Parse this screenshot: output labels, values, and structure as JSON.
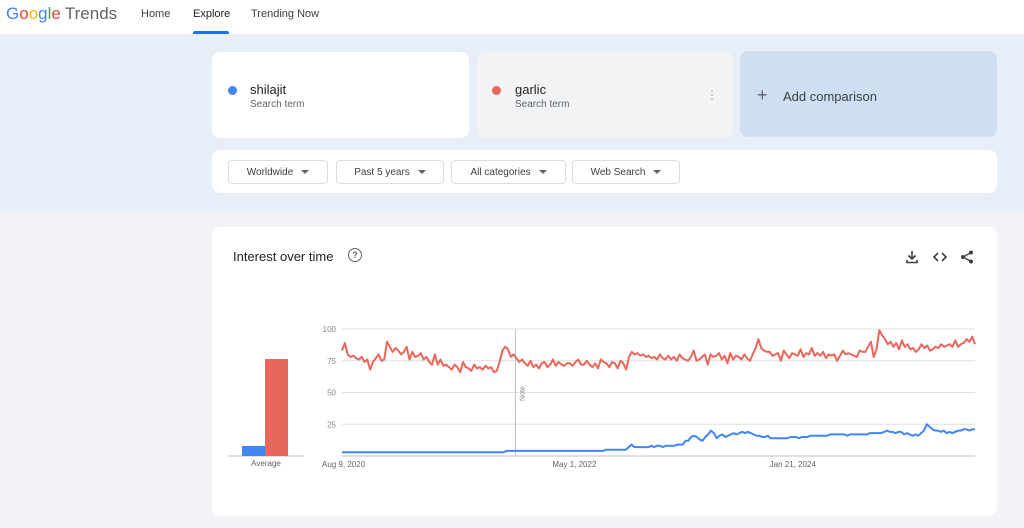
{
  "header": {
    "logo": {
      "google": [
        "G",
        "o",
        "o",
        "g",
        "l",
        "e"
      ],
      "trends": "Trends"
    },
    "nav": [
      {
        "label": "Home"
      },
      {
        "label": "Explore",
        "active": true
      },
      {
        "label": "Trending Now"
      }
    ]
  },
  "terms": [
    {
      "name": "shilajit",
      "subtitle": "Search term",
      "color": "#4285f4"
    },
    {
      "name": "garlic",
      "subtitle": "Search term",
      "color": "#e8675b"
    }
  ],
  "add_comparison": {
    "icon": "plus-icon",
    "label": "Add comparison"
  },
  "filters": [
    {
      "label": "Worldwide"
    },
    {
      "label": "Past 5 years"
    },
    {
      "label": "All categories"
    },
    {
      "label": "Web Search"
    }
  ],
  "interest_card": {
    "title": "Interest over time",
    "icons": [
      "help-icon",
      "download-icon",
      "embed-icon",
      "share-icon"
    ]
  },
  "chart_data": [
    {
      "type": "bar",
      "categories": [
        "Average"
      ],
      "series": [
        {
          "name": "shilajit",
          "values": [
            8
          ],
          "color": "#4285f4"
        },
        {
          "name": "garlic",
          "values": [
            77
          ],
          "color": "#e8675b"
        }
      ],
      "ylim": [
        0,
        100
      ]
    },
    {
      "type": "line",
      "x_ticks": [
        "Aug 9, 2020",
        "May 1, 2022",
        "Jan 21, 2024"
      ],
      "y_ticks": [
        "100",
        "75",
        "50",
        "25"
      ],
      "ylim": [
        0,
        100
      ],
      "annotation": "Note",
      "annotation_at": 0.274,
      "series": [
        {
          "name": "garlic",
          "color": "#e8675b",
          "values": [
            83,
            89,
            80,
            78,
            79,
            77,
            76,
            78,
            74,
            76,
            68,
            74,
            77,
            80,
            75,
            76,
            90,
            86,
            82,
            85,
            83,
            80,
            82,
            86,
            76,
            82,
            78,
            79,
            81,
            76,
            78,
            74,
            72,
            80,
            72,
            76,
            71,
            72,
            70,
            68,
            72,
            70,
            66,
            74,
            70,
            69,
            67,
            72,
            69,
            70,
            68,
            71,
            69,
            70,
            66,
            67,
            74,
            83,
            86,
            84,
            78,
            80,
            77,
            74,
            76,
            73,
            71,
            75,
            70,
            72,
            69,
            73,
            74,
            70,
            72,
            76,
            71,
            74,
            72,
            71,
            73,
            73,
            71,
            74,
            76,
            72,
            72,
            75,
            72,
            70,
            73,
            69,
            76,
            74,
            73,
            70,
            74,
            73,
            69,
            75,
            73,
            68,
            78,
            82,
            80,
            81,
            79,
            80,
            78,
            79,
            77,
            78,
            76,
            80,
            77,
            76,
            79,
            76,
            78,
            75,
            80,
            77,
            76,
            75,
            78,
            83,
            75,
            76,
            78,
            80,
            72,
            80,
            78,
            79,
            81,
            76,
            79,
            73,
            81,
            76,
            79,
            78,
            76,
            80,
            77,
            75,
            80,
            85,
            92,
            85,
            83,
            82,
            82,
            79,
            80,
            81,
            75,
            83,
            80,
            77,
            81,
            80,
            79,
            84,
            78,
            81,
            80,
            85,
            79,
            81,
            79,
            82,
            77,
            80,
            79,
            80,
            75,
            79,
            83,
            80,
            81,
            80,
            79,
            78,
            83,
            82,
            82,
            86,
            90,
            78,
            84,
            99,
            95,
            92,
            88,
            90,
            86,
            89,
            84,
            91,
            86,
            88,
            84,
            85,
            82,
            84,
            88,
            85,
            87,
            83,
            84,
            86,
            85,
            88,
            86,
            87,
            88,
            86,
            91,
            86,
            88,
            89,
            92,
            90,
            94,
            88
          ]
        },
        {
          "name": "shilajit",
          "color": "#4285f4",
          "values": [
            3,
            3,
            3,
            3,
            3,
            3,
            3,
            3,
            3,
            3,
            3,
            3,
            3,
            3,
            3,
            3,
            3,
            3,
            3,
            3,
            3,
            3,
            3,
            3,
            3,
            3,
            3,
            3,
            3,
            3,
            3,
            3,
            3,
            3,
            3,
            3,
            3,
            3,
            3,
            3,
            3,
            3,
            3,
            3,
            3,
            3,
            3,
            3,
            3,
            3,
            3,
            3,
            3,
            3,
            3,
            3,
            3,
            3,
            4,
            4,
            4,
            4,
            4,
            4,
            4,
            4,
            4,
            4,
            4,
            4,
            4,
            4,
            4,
            4,
            4,
            4,
            4,
            4,
            4,
            4,
            4,
            4,
            4,
            4,
            4,
            4,
            4,
            4,
            4,
            4,
            4,
            4,
            4,
            5,
            5,
            5,
            5,
            5,
            5,
            5,
            5,
            7,
            9,
            7,
            7,
            7,
            7,
            7,
            7,
            8,
            7,
            8,
            8,
            7,
            8,
            8,
            8,
            8,
            9,
            9,
            9,
            12,
            12,
            15,
            16,
            15,
            13,
            12,
            15,
            17,
            20,
            18,
            14,
            16,
            17,
            15,
            16,
            17,
            18,
            17,
            18,
            19,
            18,
            19,
            18,
            17,
            16,
            16,
            15,
            15,
            16,
            14,
            14,
            14,
            14,
            14,
            14,
            14,
            15,
            15,
            15,
            14,
            15,
            15,
            15,
            16,
            16,
            16,
            16,
            16,
            16,
            16,
            17,
            17,
            17,
            17,
            17,
            17,
            16,
            17,
            17,
            17,
            17,
            17,
            17,
            17,
            18,
            18,
            18,
            18,
            18,
            19,
            20,
            19,
            19,
            18,
            19,
            19,
            17,
            18,
            17,
            16,
            17,
            16,
            18,
            20,
            25,
            23,
            21,
            20,
            20,
            19,
            20,
            18,
            19,
            18,
            19,
            20,
            20,
            21,
            21,
            20,
            21,
            21
          ]
        }
      ]
    }
  ]
}
